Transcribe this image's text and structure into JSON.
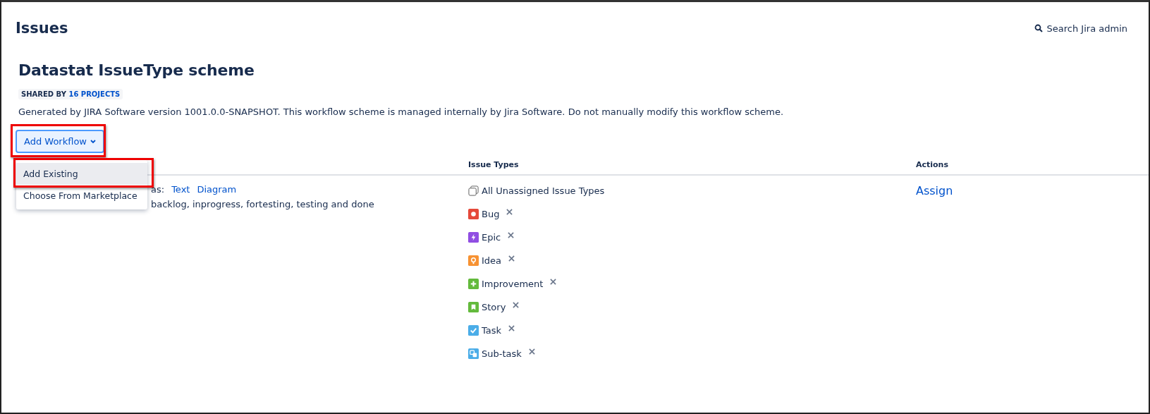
{
  "page_title": "Issues",
  "search": {
    "label": "Search Jira admin"
  },
  "scheme": {
    "title": "Datastat IssueType scheme",
    "shared_by": "SHARED BY",
    "projects_link": "16 PROJECTS",
    "description": "Generated by JIRA Software version 1001.0.0-SNAPSHOT. This workflow scheme is managed internally by Jira Software. Do not manually modify this workflow scheme."
  },
  "add_button": {
    "label": "Add Workflow",
    "highlighted": true
  },
  "menu": {
    "expanded": true,
    "items": [
      {
        "label": "Add Existing",
        "selected": true,
        "highlighted": true
      },
      {
        "label": "Choose From Marketplace",
        "selected": false,
        "highlighted": false
      }
    ]
  },
  "table": {
    "columns": [
      "Issue Types",
      "Actions"
    ],
    "row": {
      "view_as": "as:",
      "links": [
        "Text",
        "Diagram"
      ],
      "description": "backlog, inprogress, fortesting, testing and done",
      "action": "Assign",
      "issue_types": [
        {
          "label": "All Unassigned Issue Types",
          "kind": "all",
          "removable": false
        },
        {
          "label": "Bug",
          "kind": "bug",
          "color": "#e5493a",
          "removable": true
        },
        {
          "label": "Epic",
          "kind": "epic",
          "color": "#904ee2",
          "removable": true
        },
        {
          "label": "Idea",
          "kind": "idea",
          "color": "#f79232",
          "removable": true
        },
        {
          "label": "Improvement",
          "kind": "improvement",
          "color": "#63ba3c",
          "removable": true
        },
        {
          "label": "Story",
          "kind": "story",
          "color": "#63ba3c",
          "removable": true
        },
        {
          "label": "Task",
          "kind": "task",
          "color": "#4bade8",
          "removable": true
        },
        {
          "label": "Sub-task",
          "kind": "subtask",
          "color": "#4bade8",
          "removable": true
        }
      ]
    }
  }
}
